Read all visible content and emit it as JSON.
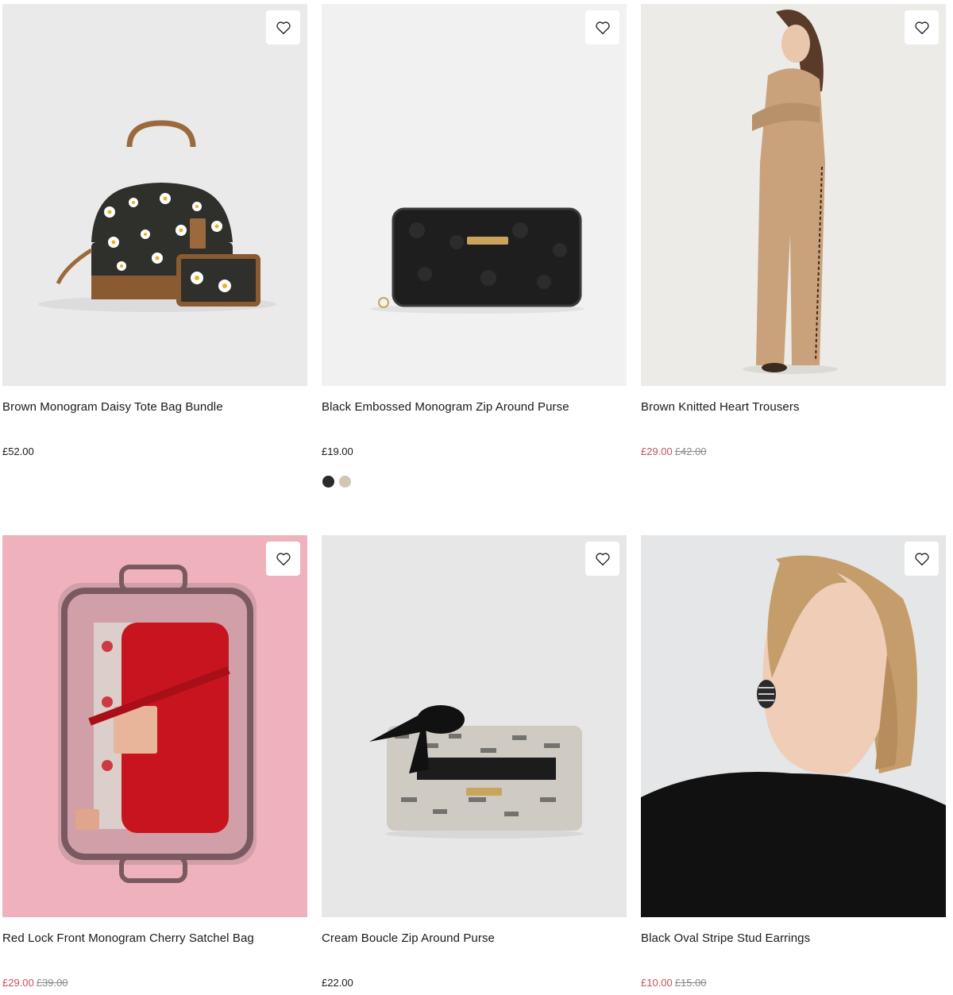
{
  "colors": {
    "sale": "#c8505a",
    "was": "#8a8a8a",
    "text": "#1a1a1a"
  },
  "products": [
    {
      "title": "Brown Monogram Daisy Tote Bag Bundle",
      "price": "£52.00",
      "wishlist_icon": "heart-outline-icon"
    },
    {
      "title": "Black Embossed Monogram Zip Around Purse",
      "price": "£19.00",
      "swatches": [
        "#2b2b2b",
        "#cfc7b4"
      ],
      "wishlist_icon": "heart-outline-icon"
    },
    {
      "title": "Brown Knitted Heart Trousers",
      "sale_price": "£29.00",
      "was_price": "£42.00",
      "wishlist_icon": "heart-outline-icon"
    },
    {
      "title": "Red Lock Front Monogram Cherry Satchel Bag",
      "sale_price": "£29.00",
      "was_price": "£39.00",
      "wishlist_icon": "heart-outline-icon"
    },
    {
      "title": "Cream Boucle Zip Around Purse",
      "price": "£22.00",
      "wishlist_icon": "heart-outline-icon"
    },
    {
      "title": "Black Oval Stripe Stud Earrings",
      "sale_price": "£10.00",
      "was_price": "£15.00",
      "wishlist_icon": "heart-outline-icon"
    }
  ]
}
